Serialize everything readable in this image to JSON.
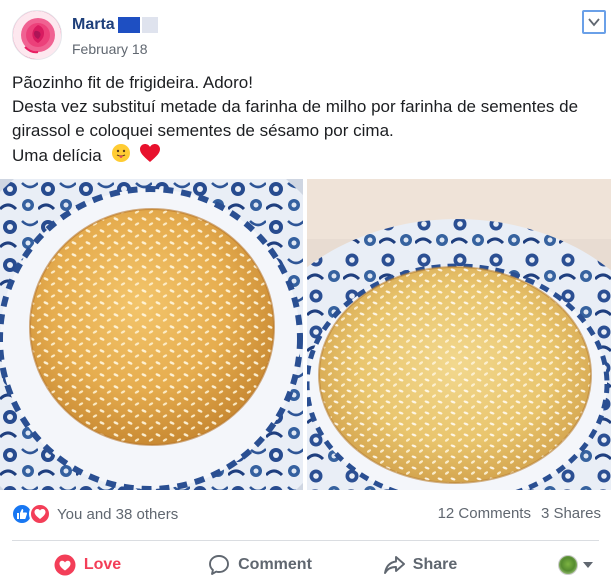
{
  "post": {
    "author": "Marta",
    "date": "February 18",
    "text_lines": [
      "Pãozinho fit de frigideira. Adoro!",
      "Desta vez substituí metade da farinha de milho por farinha de sementes de",
      "girassol e coloquei sementes de sésamo por cima.",
      "Uma delícia"
    ],
    "emojis": [
      "tongue-face-icon",
      "red-heart-icon"
    ]
  },
  "reactions": {
    "summary": "You and 38 others",
    "icons": [
      "like-icon",
      "love-icon"
    ],
    "comments": "12 Comments",
    "shares": "3 Shares"
  },
  "actions": {
    "love": "Love",
    "comment": "Comment",
    "share": "Share"
  },
  "colors": {
    "author_link": "#1e3f7a",
    "love": "#f33e58",
    "like": "#1877f2",
    "muted": "#606770"
  }
}
